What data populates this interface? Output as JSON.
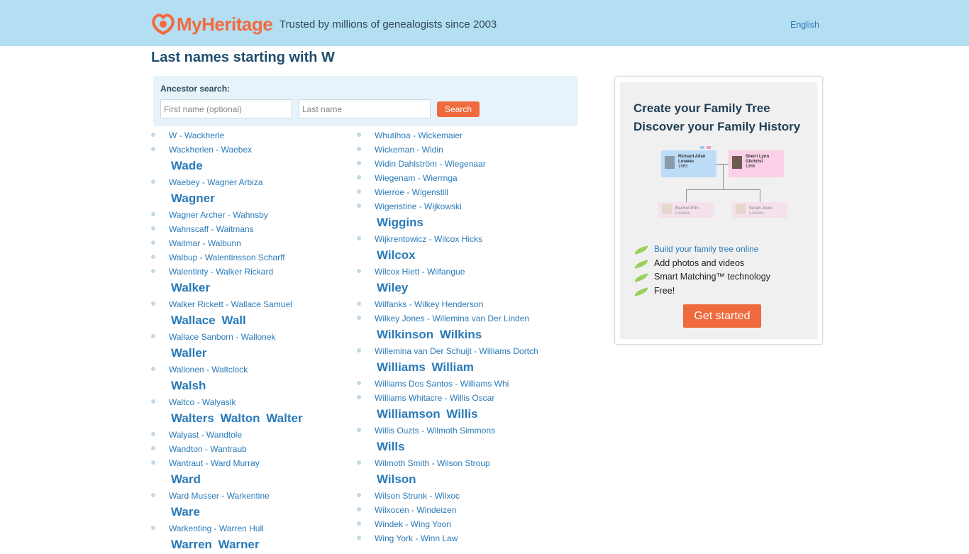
{
  "header": {
    "logo_text": "MyHeritage",
    "tagline": "Trusted by millions of genealogists since 2003",
    "language": "English",
    "brand_color": "#f26a3d",
    "bar_color": "#b4def2"
  },
  "page_title": "Last names starting with W",
  "search": {
    "label": "Ancestor search:",
    "first_placeholder": "First name (optional)",
    "last_placeholder": "Last name",
    "button": "Search"
  },
  "col1": [
    {
      "kind": "range",
      "text": "W - Wackherle"
    },
    {
      "kind": "range",
      "text": "Wackherlen - Waebex"
    },
    {
      "kind": "heading",
      "text": "Wade"
    },
    {
      "kind": "range",
      "text": "Waebey - Wagner Arbiza"
    },
    {
      "kind": "heading",
      "text": "Wagner"
    },
    {
      "kind": "range",
      "text": "Wagner Archer - Wahnsby"
    },
    {
      "kind": "range",
      "text": "Wahnscaff - Waitmans"
    },
    {
      "kind": "range",
      "text": "Waitmar - Walbunn"
    },
    {
      "kind": "range",
      "text": "Walbup - Walentinsson Scharff"
    },
    {
      "kind": "range",
      "text": "Walentinty - Walker Rickard"
    },
    {
      "kind": "heading",
      "text": "Walker"
    },
    {
      "kind": "range",
      "text": "Walker Rickett - Wallace Samuel"
    },
    {
      "kind": "heading",
      "text": "Wallace Wall"
    },
    {
      "kind": "range",
      "text": "Wallace Sanborn - Wallonek"
    },
    {
      "kind": "heading",
      "text": "Waller"
    },
    {
      "kind": "range",
      "text": "Wallonen - Waltclock"
    },
    {
      "kind": "heading",
      "text": "Walsh"
    },
    {
      "kind": "range",
      "text": "Waltco - Walyaslk"
    },
    {
      "kind": "heading",
      "text": "Walters Walton Walter"
    },
    {
      "kind": "range",
      "text": "Walyast - Wandtole"
    },
    {
      "kind": "range",
      "text": "Wandton - Wantraub"
    },
    {
      "kind": "range",
      "text": "Wantraut - Ward Murray"
    },
    {
      "kind": "heading",
      "text": "Ward"
    },
    {
      "kind": "range",
      "text": "Ward Musser - Warkentine"
    },
    {
      "kind": "heading",
      "text": "Ware"
    },
    {
      "kind": "range",
      "text": "Warkenting - Warren Hull"
    },
    {
      "kind": "heading",
      "text": "Warren Warner"
    }
  ],
  "col2": [
    {
      "kind": "range",
      "text": "Whutihoa - Wickemaier"
    },
    {
      "kind": "range",
      "text": "Wickeman - Widin"
    },
    {
      "kind": "range",
      "text": "Widin Dahlström - Wiegenaar"
    },
    {
      "kind": "range",
      "text": "Wiegenam - Wierrnga"
    },
    {
      "kind": "range",
      "text": "Wierroe - Wigenstill"
    },
    {
      "kind": "range",
      "text": "Wigenstine - Wijkowski"
    },
    {
      "kind": "heading",
      "text": "Wiggins"
    },
    {
      "kind": "range",
      "text": "Wijkrentowicz - Wilcox Hicks"
    },
    {
      "kind": "heading",
      "text": "Wilcox"
    },
    {
      "kind": "range",
      "text": "Wilcox Hiett - Wilfangue"
    },
    {
      "kind": "heading",
      "text": "Wiley"
    },
    {
      "kind": "range",
      "text": "Wilfanks - Wilkey Henderson"
    },
    {
      "kind": "range",
      "text": "Wilkey Jones - Willemina van Der Linden"
    },
    {
      "kind": "heading",
      "text": "Wilkinson Wilkins"
    },
    {
      "kind": "range",
      "text": "Willemina van Der Schuijt - Williams Dortch"
    },
    {
      "kind": "heading",
      "text": "Williams William"
    },
    {
      "kind": "range",
      "text": "Williams Dos Santos - Williams Whi"
    },
    {
      "kind": "range",
      "text": "Williams Whitacre - Willis Oscar"
    },
    {
      "kind": "heading",
      "text": "Williamson Willis"
    },
    {
      "kind": "range",
      "text": "Willis Ouzts - Wilmoth Simmons"
    },
    {
      "kind": "heading",
      "text": "Wills"
    },
    {
      "kind": "range",
      "text": "Wilmoth Smith - Wilson Stroup"
    },
    {
      "kind": "heading",
      "text": "Wilson"
    },
    {
      "kind": "range",
      "text": "Wilson Strunk - Wilxoc"
    },
    {
      "kind": "range",
      "text": "Wilxocen - Windeizen"
    },
    {
      "kind": "range",
      "text": "Windek - Wing Yoon"
    },
    {
      "kind": "range",
      "text": "Wing York - Winn Law"
    }
  ],
  "promo": {
    "title_line1": "Create your Family Tree",
    "title_line2": "Discover your Family History",
    "tree": {
      "p1_name1": "Richard Allen",
      "p1_name2": "Loweke",
      "p1_year": "1963",
      "p2_name1": "Sherri Lynn",
      "p2_name2": "Gilchrist",
      "p2_year": "1966",
      "c1_name1": "Rachel Erin",
      "c1_name2": "Loweke",
      "c2_name1": "Sarah Jean",
      "c2_name2": "Loweke"
    },
    "features": [
      {
        "text": "Build your family tree online",
        "link": true
      },
      {
        "text": "Add photos and videos",
        "link": false
      },
      {
        "text": "Smart Matching™ technology",
        "link": false
      },
      {
        "text": "Free!",
        "link": false
      }
    ],
    "cta": "Get started"
  }
}
